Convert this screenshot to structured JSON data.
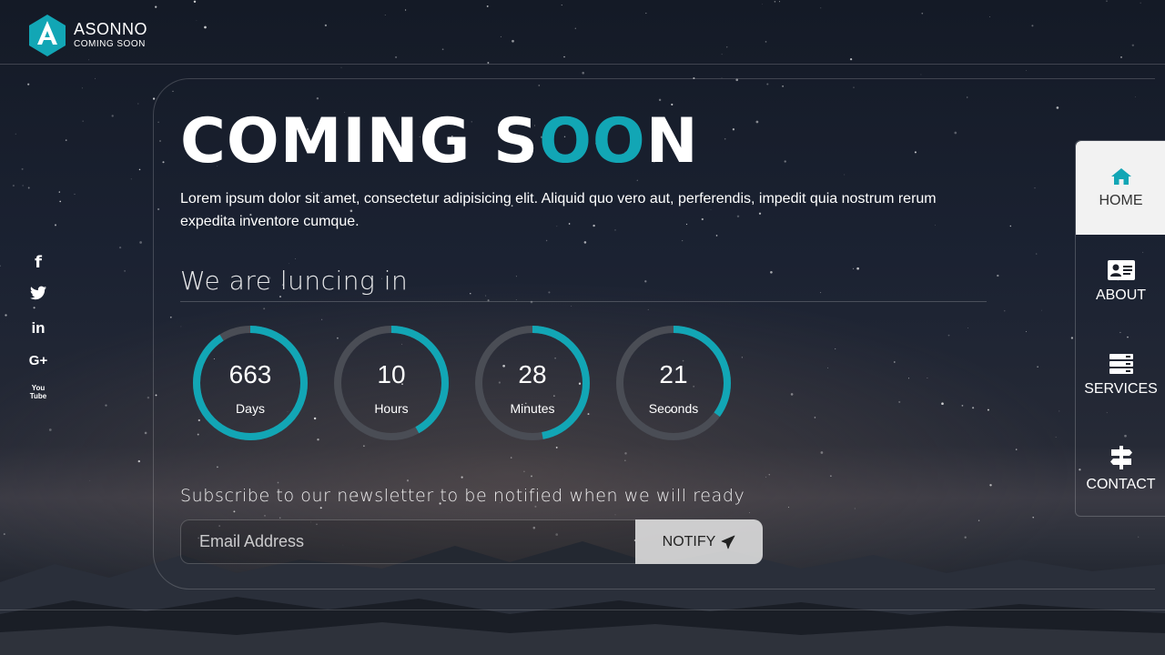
{
  "brand": {
    "name": "ASONNO",
    "tagline": "COMING SOON"
  },
  "social": [
    {
      "icon": "facebook-icon",
      "glyph": "f"
    },
    {
      "icon": "twitter-icon",
      "glyph": "t"
    },
    {
      "icon": "linkedin-icon",
      "glyph": "in"
    },
    {
      "icon": "google-plus-icon",
      "glyph": "G+"
    },
    {
      "icon": "youtube-icon",
      "glyph": "You Tube"
    }
  ],
  "headline": {
    "part1": "COMING S",
    "accent": "OO",
    "part2": "N"
  },
  "intro": "Lorem ipsum dolor sit amet, consectetur adipisicing elit. Aliquid quo vero aut, perferendis, impedit quia nostrum rerum expedita inventore cumque.",
  "launch_title": "We are luncing in",
  "countdown": [
    {
      "value": "663",
      "label": "Days",
      "fraction": 0.91
    },
    {
      "value": "10",
      "label": "Hours",
      "fraction": 0.42
    },
    {
      "value": "28",
      "label": "Minutes",
      "fraction": 0.47
    },
    {
      "value": "21",
      "label": "Seconds",
      "fraction": 0.35
    }
  ],
  "subscribe_text": "Subscribe to our newsletter to be notified when we will ready",
  "form": {
    "placeholder": "Email Address",
    "button_label": "NOTIFY"
  },
  "nav": [
    {
      "label": "HOME",
      "icon": "home-icon",
      "active": true
    },
    {
      "label": "ABOUT",
      "icon": "id-card-icon",
      "active": false
    },
    {
      "label": "SERVICES",
      "icon": "server-icon",
      "active": false
    },
    {
      "label": "CONTACT",
      "icon": "signpost-icon",
      "active": false
    }
  ],
  "colors": {
    "accent": "#12a6b5",
    "ring_track": "#4a4d55",
    "nav_active_bg": "#f2f2f2"
  }
}
